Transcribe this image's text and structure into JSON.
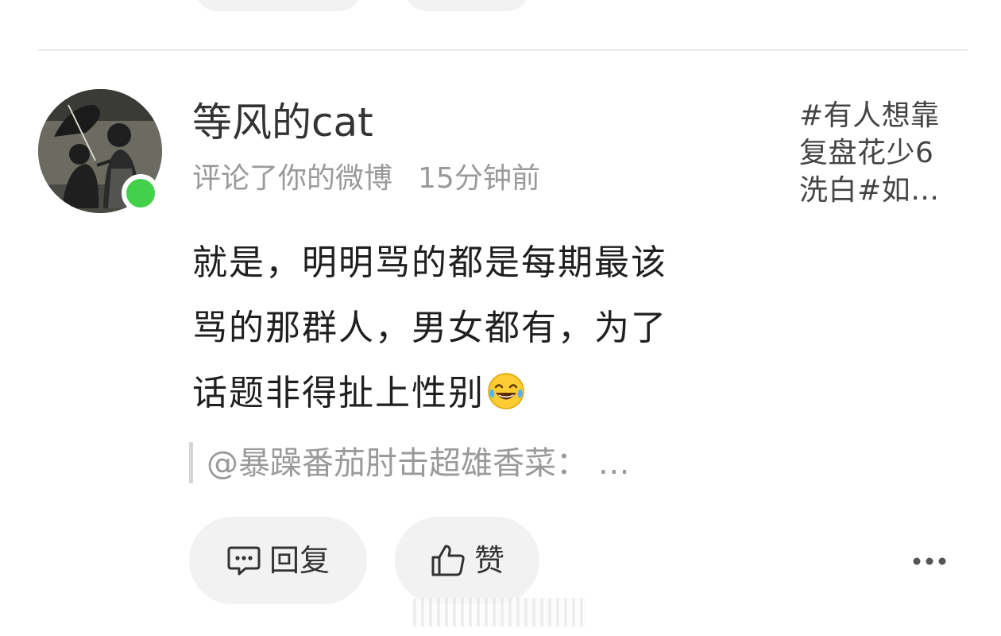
{
  "comment": {
    "user_name": "等风的cat",
    "action": "评论了你的微博",
    "time": "15分钟前",
    "online": true,
    "weibo_ref": {
      "lines": [
        "#有人想靠",
        "复盘花少6",
        "洗白#如…"
      ]
    },
    "body_lines": [
      "就是，明明骂的都是每期最该",
      "骂的那群人，男女都有，为了",
      "话题非得扯上性别"
    ],
    "body_emoji": "laughing-tears-emoji",
    "quote": "@暴躁番茄肘击超雄香菜：  …",
    "actions": {
      "reply_label": "回复",
      "like_label": "赞"
    }
  },
  "colors": {
    "online_dot": "#43d04a",
    "pill_bg": "#f2f2f2",
    "muted_text": "#9a9a9a",
    "primary_text": "#1f1f1f"
  }
}
